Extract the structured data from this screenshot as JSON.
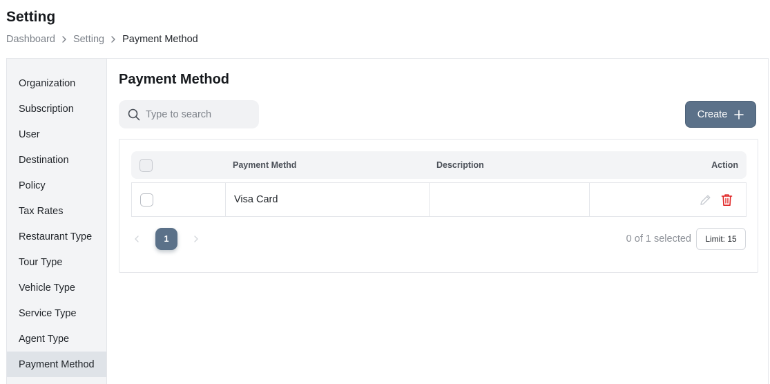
{
  "page": {
    "title": "Setting"
  },
  "breadcrumb": {
    "items": [
      "Dashboard",
      "Setting",
      "Payment Method"
    ]
  },
  "sidebar": {
    "items": [
      {
        "label": "Organization"
      },
      {
        "label": "Subscription"
      },
      {
        "label": "User"
      },
      {
        "label": "Destination"
      },
      {
        "label": "Policy"
      },
      {
        "label": "Tax Rates"
      },
      {
        "label": "Restaurant Type"
      },
      {
        "label": "Tour Type"
      },
      {
        "label": "Vehicle Type"
      },
      {
        "label": "Service Type"
      },
      {
        "label": "Agent Type"
      },
      {
        "label": "Payment Method",
        "active": true
      }
    ]
  },
  "main": {
    "title": "Payment Method",
    "search": {
      "placeholder": "Type to search",
      "value": ""
    },
    "create_label": "Create",
    "table": {
      "columns": [
        "",
        "Payment Methd",
        "Description",
        "Action"
      ],
      "rows": [
        {
          "payment_method": "Visa Card",
          "description": ""
        }
      ]
    },
    "pagination": {
      "current_page": "1",
      "selected_text": "0 of 1 selected",
      "limit_label": "Limit: 15"
    }
  },
  "colors": {
    "primary": "#5b7189",
    "delete": "#e02424",
    "edit": "#c4c8ce",
    "sidebar_bg": "#f3f4f6",
    "sidebar_active": "#dfe3e8"
  },
  "icons": [
    "chevron-right-icon",
    "search-icon",
    "plus-icon",
    "pencil-icon",
    "trash-icon",
    "chevron-left-icon"
  ]
}
